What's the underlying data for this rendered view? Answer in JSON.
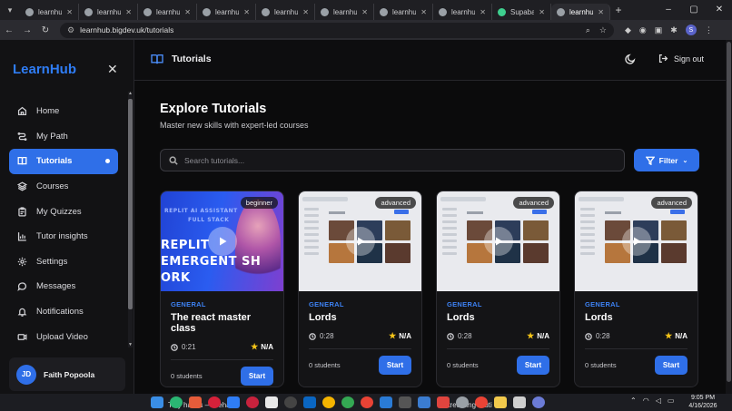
{
  "browser": {
    "tabs": [
      {
        "label": "learnhub.b"
      },
      {
        "label": "learnhub.b"
      },
      {
        "label": "learnhub.b"
      },
      {
        "label": "learnhub.b"
      },
      {
        "label": "learnhub.b"
      },
      {
        "label": "learnhub."
      },
      {
        "label": "learnhub."
      },
      {
        "label": "learnhub.b"
      },
      {
        "label": "Supabase"
      },
      {
        "label": "learnhub.b"
      }
    ],
    "url": "learnhub.bigdev.uk/tutorials",
    "profile_initial": "S"
  },
  "sidebar": {
    "brand": "LearnHub",
    "items": [
      {
        "label": "Home",
        "icon": "home-icon"
      },
      {
        "label": "My Path",
        "icon": "path-icon"
      },
      {
        "label": "Tutorials",
        "icon": "book-icon"
      },
      {
        "label": "Courses",
        "icon": "layers-icon"
      },
      {
        "label": "My Quizzes",
        "icon": "clipboard-icon"
      },
      {
        "label": "Tutor insights",
        "icon": "chart-icon"
      },
      {
        "label": "Settings",
        "icon": "gear-icon"
      },
      {
        "label": "Messages",
        "icon": "message-icon"
      },
      {
        "label": "Notifications",
        "icon": "bell-icon"
      },
      {
        "label": "Upload Video",
        "icon": "video-icon"
      }
    ],
    "active_index": 2,
    "user": {
      "initials": "JD",
      "name": "Faith Popoola"
    }
  },
  "header": {
    "title": "Tutorials",
    "signout_label": "Sign out"
  },
  "main": {
    "title": "Explore Tutorials",
    "subtitle": "Master new skills with expert-led courses",
    "search_placeholder": "Search tutorials...",
    "filter_label": "Filter",
    "cards": [
      {
        "level": "beginner",
        "category": "GENERAL",
        "title": "The react master class",
        "duration": "0:21",
        "rating": "N/A",
        "students": "0 students",
        "start_label": "Start",
        "thumb": "video"
      },
      {
        "level": "advanced",
        "category": "GENERAL",
        "title": "Lords",
        "duration": "0:28",
        "rating": "N/A",
        "students": "0 students",
        "start_label": "Start",
        "thumb": "screenshot"
      },
      {
        "level": "advanced",
        "category": "GENERAL",
        "title": "Lords",
        "duration": "0:28",
        "rating": "N/A",
        "students": "0 students",
        "start_label": "Start",
        "thumb": "screenshot"
      },
      {
        "level": "advanced",
        "category": "GENERAL",
        "title": "Lords",
        "duration": "0:28",
        "rating": "N/A",
        "students": "0 students",
        "start_label": "Start",
        "thumb": "screenshot"
      }
    ],
    "video_thumb_text": [
      "REPLIT",
      "EMERGENT SH",
      "ORK"
    ],
    "video_thumb_small_text": [
      "REPLIT AI ASSISTANT",
      "FULL STACK"
    ]
  },
  "taskbar": {
    "ghost_left": "Tiny habits — behav",
    "ghost_right": "Stretching routi",
    "time": "9:05 PM",
    "date": "4/16/2026"
  },
  "colors": {
    "accent": "#2f6fe8",
    "brand": "#2f7df6",
    "category": "#3d82f4",
    "star": "#f5c518",
    "background": "#0b0b0c"
  }
}
